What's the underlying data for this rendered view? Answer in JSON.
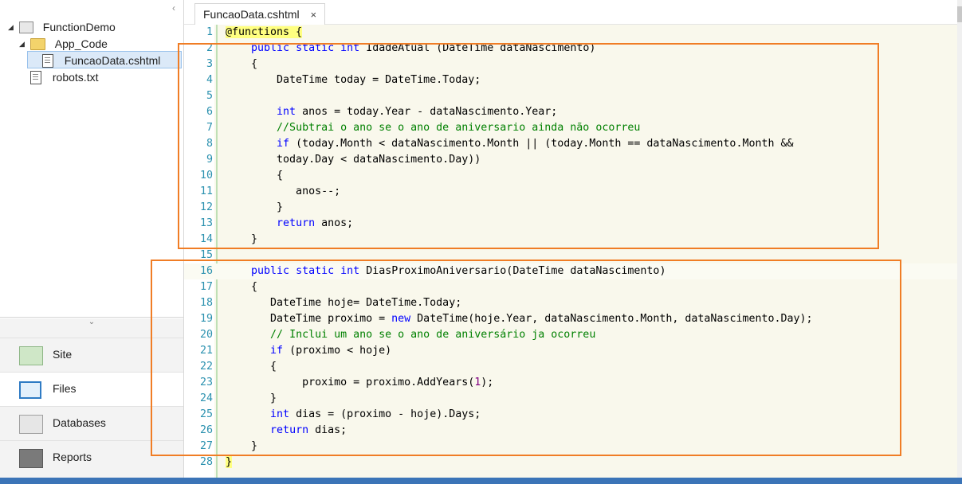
{
  "tree": {
    "project": "FunctionDemo",
    "folder": "App_Code",
    "selected_file": "FuncaoData.cshtml",
    "other_file": "robots.txt"
  },
  "nav": {
    "site": "Site",
    "files": "Files",
    "databases": "Databases",
    "reports": "Reports"
  },
  "tab": {
    "title": "FuncaoData.cshtml",
    "close": "×"
  },
  "code_lines": [
    {
      "n": "1",
      "s": [
        {
          "t": "@functions {",
          "c": "rz"
        }
      ]
    },
    {
      "n": "2",
      "s": [
        {
          "t": "    "
        },
        {
          "t": "public",
          "c": "kw"
        },
        {
          "t": " "
        },
        {
          "t": "static",
          "c": "kw"
        },
        {
          "t": " "
        },
        {
          "t": "int",
          "c": "kw"
        },
        {
          "t": " IdadeAtual (DateTime dataNascimento)"
        }
      ]
    },
    {
      "n": "3",
      "s": [
        {
          "t": "    {"
        }
      ]
    },
    {
      "n": "4",
      "s": [
        {
          "t": "        DateTime today = DateTime.Today;"
        }
      ]
    },
    {
      "n": "5",
      "s": [
        {
          "t": ""
        }
      ]
    },
    {
      "n": "6",
      "s": [
        {
          "t": "        "
        },
        {
          "t": "int",
          "c": "kw"
        },
        {
          "t": " anos = today.Year - dataNascimento.Year;"
        }
      ]
    },
    {
      "n": "7",
      "s": [
        {
          "t": "        "
        },
        {
          "t": "//Subtrai o ano se o ano de aniversario ainda não ocorreu",
          "c": "cm"
        }
      ]
    },
    {
      "n": "8",
      "s": [
        {
          "t": "        "
        },
        {
          "t": "if",
          "c": "kw"
        },
        {
          "t": " (today.Month < dataNascimento.Month || (today.Month == dataNascimento.Month &&"
        }
      ]
    },
    {
      "n": "9",
      "s": [
        {
          "t": "        today.Day < dataNascimento.Day))"
        }
      ]
    },
    {
      "n": "10",
      "s": [
        {
          "t": "        {"
        }
      ]
    },
    {
      "n": "11",
      "s": [
        {
          "t": "           anos--;"
        }
      ]
    },
    {
      "n": "12",
      "s": [
        {
          "t": "        }"
        }
      ]
    },
    {
      "n": "13",
      "s": [
        {
          "t": "        "
        },
        {
          "t": "return",
          "c": "kw"
        },
        {
          "t": " anos;"
        }
      ]
    },
    {
      "n": "14",
      "s": [
        {
          "t": "    }"
        }
      ]
    },
    {
      "n": "15",
      "s": [
        {
          "t": ""
        }
      ]
    },
    {
      "n": "16",
      "s": [
        {
          "t": "    "
        },
        {
          "t": "public",
          "c": "kw"
        },
        {
          "t": " "
        },
        {
          "t": "static",
          "c": "kw"
        },
        {
          "t": " "
        },
        {
          "t": "int",
          "c": "kw"
        },
        {
          "t": " DiasProximoAniversario(DateTime dataNascimento)"
        }
      ]
    },
    {
      "n": "17",
      "s": [
        {
          "t": "    {"
        }
      ]
    },
    {
      "n": "18",
      "s": [
        {
          "t": "       DateTime hoje= DateTime.Today;"
        }
      ]
    },
    {
      "n": "19",
      "s": [
        {
          "t": "       DateTime proximo = "
        },
        {
          "t": "new",
          "c": "kw"
        },
        {
          "t": " DateTime(hoje.Year, dataNascimento.Month, dataNascimento.Day);"
        }
      ]
    },
    {
      "n": "20",
      "s": [
        {
          "t": "       "
        },
        {
          "t": "// Inclui um ano se o ano de aniversário ja ocorreu",
          "c": "cm"
        }
      ]
    },
    {
      "n": "21",
      "s": [
        {
          "t": "       "
        },
        {
          "t": "if",
          "c": "kw"
        },
        {
          "t": " (proximo < hoje)"
        }
      ]
    },
    {
      "n": "22",
      "s": [
        {
          "t": "       {"
        }
      ]
    },
    {
      "n": "23",
      "s": [
        {
          "t": "            proximo = proximo.AddYears("
        },
        {
          "t": "1",
          "c": "num"
        },
        {
          "t": ");"
        }
      ]
    },
    {
      "n": "24",
      "s": [
        {
          "t": "       }"
        }
      ]
    },
    {
      "n": "25",
      "s": [
        {
          "t": "       "
        },
        {
          "t": "int",
          "c": "kw"
        },
        {
          "t": " dias = (proximo - hoje).Days;"
        }
      ]
    },
    {
      "n": "26",
      "s": [
        {
          "t": "       "
        },
        {
          "t": "return",
          "c": "kw"
        },
        {
          "t": " dias;"
        }
      ]
    },
    {
      "n": "27",
      "s": [
        {
          "t": "    }"
        }
      ]
    },
    {
      "n": "28",
      "s": [
        {
          "t": "}",
          "c": "rz"
        }
      ]
    }
  ],
  "colors": {
    "highlight_box": "#f07d25",
    "keyword": "#0000ff",
    "comment": "#008000",
    "line_number": "#2b91af"
  }
}
